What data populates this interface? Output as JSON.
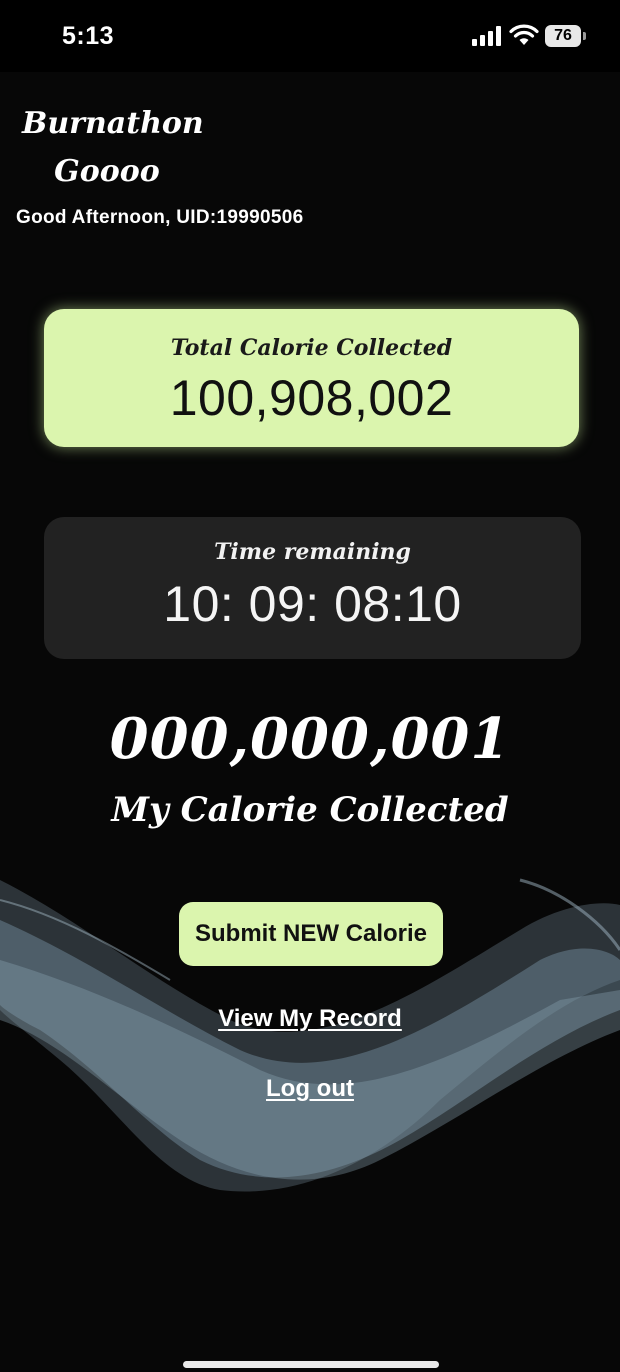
{
  "status_bar": {
    "time": "5:13",
    "battery": "76",
    "icons": [
      "signal-icon",
      "wifi-icon",
      "battery-icon"
    ]
  },
  "header": {
    "title_line1": "Burnathon",
    "title_line2": "Goooo",
    "greeting": "Good Afternoon, UID:19990506"
  },
  "total_card": {
    "label": "Total Calorie Collected",
    "value": "100,908,002"
  },
  "time_card": {
    "label": "Time remaining",
    "value": "10: 09: 08:10"
  },
  "my_calories": {
    "value": "000,000,001",
    "label": "My Calorie Collected"
  },
  "actions": {
    "submit_label": "Submit NEW Calorie",
    "record_label": "View My Record",
    "logout_label": "Log out"
  },
  "colors": {
    "accent": "#dbf5ae",
    "background": "#070707",
    "card_dark": "#222222"
  }
}
